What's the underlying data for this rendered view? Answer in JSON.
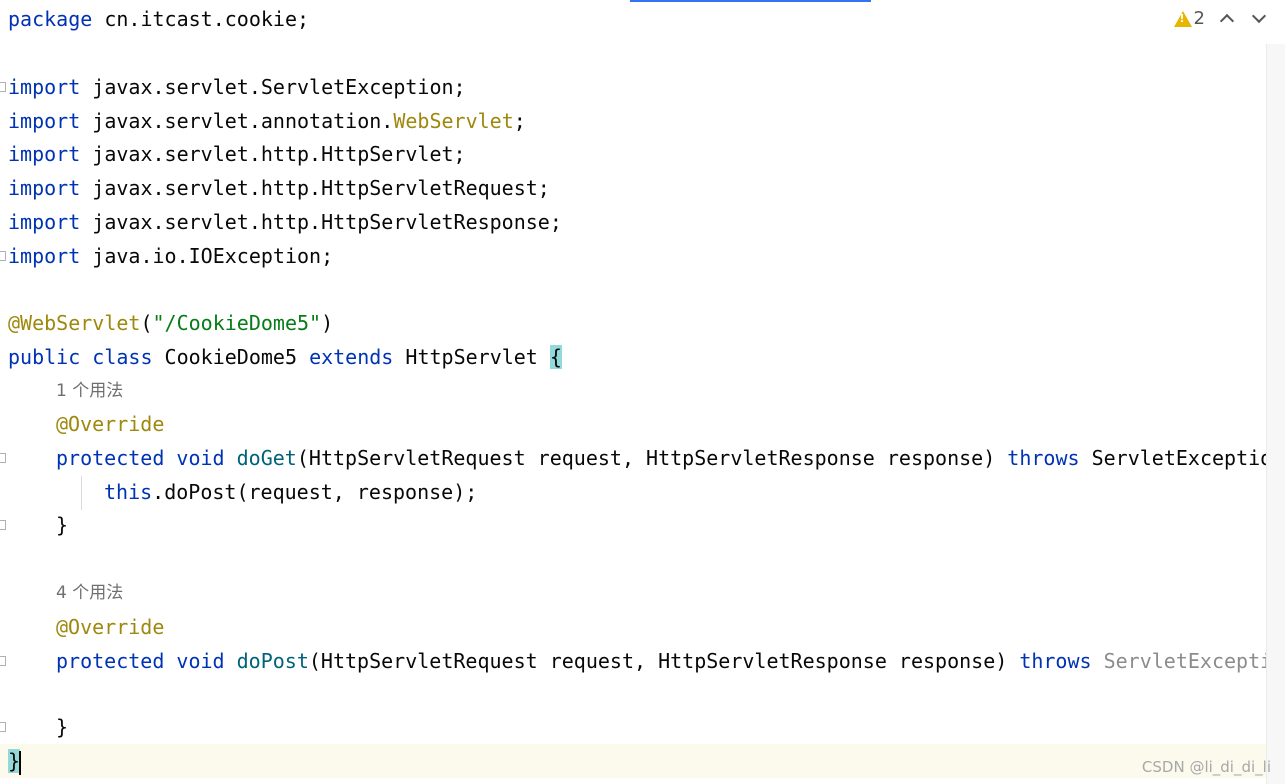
{
  "inspection": {
    "warning_count": "2",
    "warning_icon": "warning-triangle-icon",
    "prev_icon": "chevron-up-icon",
    "next_icon": "chevron-down-icon",
    "warning_color": "#e8b500"
  },
  "code": {
    "line1": {
      "kw": "package",
      "rest": " cn.itcast.cookie;"
    },
    "line3": {
      "kw": "import",
      "rest": " javax.servlet.ServletException;"
    },
    "line4": {
      "kw": "import",
      "pre": " javax.servlet.annotation.",
      "ann": "WebServlet",
      "post": ";"
    },
    "line5": {
      "kw": "import",
      "rest": " javax.servlet.http.HttpServlet;"
    },
    "line6": {
      "kw": "import",
      "rest": " javax.servlet.http.HttpServletRequest;"
    },
    "line7": {
      "kw": "import",
      "rest": " javax.servlet.http.HttpServletResponse;"
    },
    "line8": {
      "kw": "import",
      "rest": " java.io.IOException;"
    },
    "line10": {
      "ann": "@WebServlet",
      "open": "(",
      "str": "\"/CookieDome5\"",
      "close": ")"
    },
    "line11": {
      "kw1": "public",
      "kw2": "class",
      "name": " CookieDome5 ",
      "kw3": "extends",
      "sup": " HttpServlet ",
      "brace": "{"
    },
    "hint1": "1 个用法",
    "line12": {
      "ann": "@Override"
    },
    "line13": {
      "kw1": "protected",
      "kw2": "void",
      "fn": "doGet",
      "params": "(HttpServletRequest request, HttpServletResponse response) ",
      "kw3": "throws",
      "exc": " ServletException"
    },
    "line14": {
      "kw": "this",
      "rest": ".doPost(request, response);"
    },
    "line15": "}",
    "hint2": "4 个用法",
    "line17": {
      "ann": "@Override"
    },
    "line18": {
      "kw1": "protected",
      "kw2": "void",
      "fn": "doPost",
      "params": "(HttpServletRequest request, HttpServletResponse response) ",
      "kw3": "throws",
      "exc": " ServletExceptio"
    },
    "line20": "}",
    "line21": "}"
  },
  "colors": {
    "keyword": "#0033b3",
    "annotation": "#9e880d",
    "string": "#067d17",
    "method": "#00627a",
    "brace_highlight": "#93d9d9",
    "current_line": "#fcfaed"
  },
  "watermark": "CSDN @li_di_di_li"
}
